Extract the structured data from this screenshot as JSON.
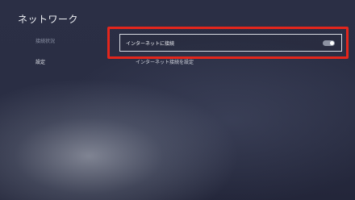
{
  "header": {
    "title": "ネットワーク"
  },
  "sidebar": {
    "items": [
      {
        "label": "接続状況",
        "state": "dim"
      },
      {
        "label": "設定",
        "state": "active"
      }
    ]
  },
  "main": {
    "internet_toggle": {
      "label": "インターネットに接続",
      "enabled": true
    },
    "setup_label": "インターネット接続を設定"
  },
  "colors": {
    "highlight": "#e3261c",
    "background": "#2a2e44",
    "toggle_track": "#8d92a2",
    "toggle_knob": "#ffffff"
  }
}
